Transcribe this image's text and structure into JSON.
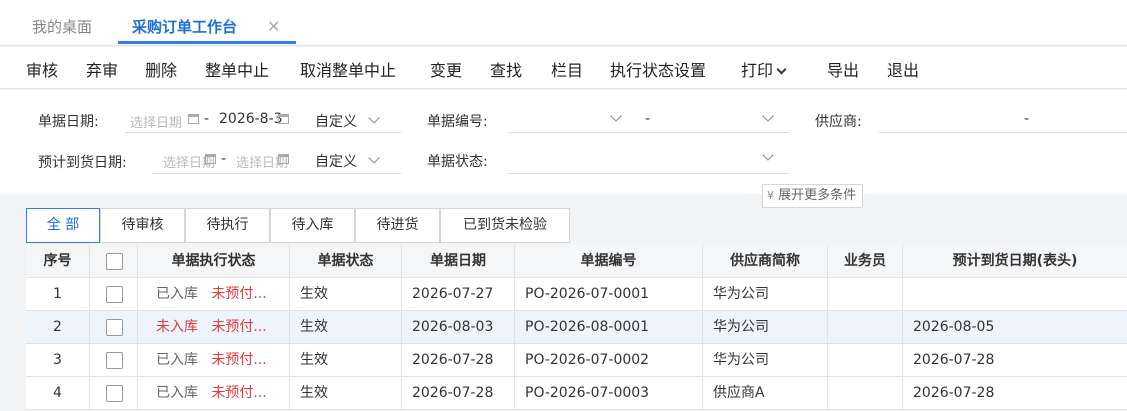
{
  "tabs": [
    {
      "label": "我的桌面"
    },
    {
      "label": "采购订单工作台"
    }
  ],
  "toolbar": {
    "audit": "审核",
    "unaudit": "弃审",
    "delete": "删除",
    "suspend_all": "整单中止",
    "cancel_suspend": "取消整单中止",
    "change": "变更",
    "find": "查找",
    "columns": "栏目",
    "exec_status_settings": "执行状态设置",
    "print": "打印",
    "export": "导出",
    "exit": "退出"
  },
  "filters": {
    "doc_date_label": "单据日期:",
    "doc_date_from_placeholder": "选择日期",
    "doc_date_to": "2026-8-3",
    "range_sep": "-",
    "doc_date_mode": "自定义",
    "doc_no_label": "单据编号:",
    "doc_no_sep": "-",
    "supplier_label": "供应商:",
    "supplier_sep": "-",
    "eta_label": "预计到货日期:",
    "eta_from_placeholder": "选择日期",
    "eta_to_placeholder": "选择日期",
    "eta_mode": "自定义",
    "status_label": "单据状态:",
    "expand_more": "展开更多条件"
  },
  "status_tabs": [
    {
      "label": "全 部",
      "active": true
    },
    {
      "label": "待审核"
    },
    {
      "label": "待执行"
    },
    {
      "label": "待入库"
    },
    {
      "label": "待进货"
    },
    {
      "label": "已到货未检验"
    }
  ],
  "table": {
    "columns": [
      "序号",
      "单据执行状态",
      "单据状态",
      "单据日期",
      "单据编号",
      "供应商简称",
      "业务员",
      "预计到货日期(表头)"
    ],
    "rows": [
      {
        "no": "1",
        "exec1": "已入库",
        "exec2": "未预付...",
        "status": "生效",
        "date": "2026-07-27",
        "code": "PO-2026-07-0001",
        "supplier": "华为公司",
        "clerk": "",
        "eta": ""
      },
      {
        "no": "2",
        "exec1": "未入库",
        "exec2": "未预付...",
        "status": "生效",
        "date": "2026-08-03",
        "code": "PO-2026-08-0001",
        "supplier": "华为公司",
        "clerk": "",
        "eta": "2026-08-05"
      },
      {
        "no": "3",
        "exec1": "已入库",
        "exec2": "未预付...",
        "status": "生效",
        "date": "2026-07-28",
        "code": "PO-2026-07-0002",
        "supplier": "华为公司",
        "clerk": "",
        "eta": "2026-07-28"
      },
      {
        "no": "4",
        "exec1": "已入库",
        "exec2": "未预付...",
        "status": "生效",
        "date": "2026-07-28",
        "code": "PO-2026-07-0003",
        "supplier": "供应商A",
        "clerk": "",
        "eta": "2026-07-28"
      }
    ]
  },
  "colors": {
    "accent": "#2e7ef0",
    "warn": "#e03c3c"
  }
}
